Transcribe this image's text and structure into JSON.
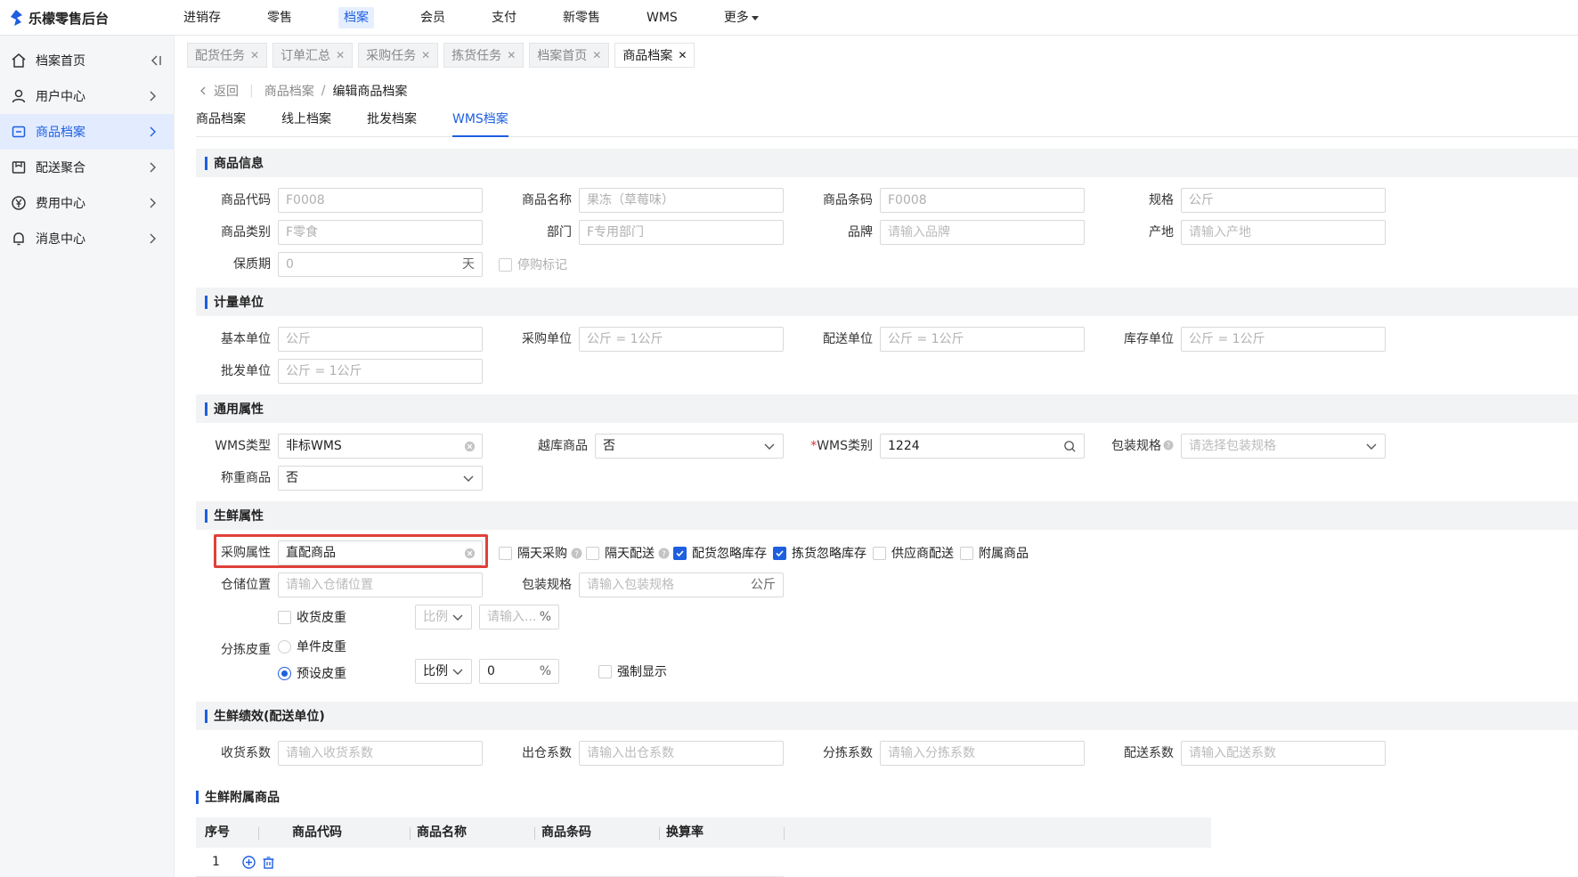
{
  "app": {
    "title": "乐檬零售后台"
  },
  "topnav": [
    {
      "label": "进销存",
      "active": false
    },
    {
      "label": "零售",
      "active": false
    },
    {
      "label": "档案",
      "active": true
    },
    {
      "label": "会员",
      "active": false
    },
    {
      "label": "支付",
      "active": false
    },
    {
      "label": "新零售",
      "active": false
    },
    {
      "label": "WMS",
      "active": false
    },
    {
      "label": "更多",
      "active": false
    }
  ],
  "sidebar": [
    {
      "label": "档案首页",
      "icon": "home-icon"
    },
    {
      "label": "用户中心",
      "icon": "user-icon"
    },
    {
      "label": "商品档案",
      "icon": "product-icon",
      "active": true
    },
    {
      "label": "配送聚合",
      "icon": "delivery-icon"
    },
    {
      "label": "费用中心",
      "icon": "yen-icon"
    },
    {
      "label": "消息中心",
      "icon": "bell-icon"
    }
  ],
  "tabs": [
    {
      "label": "配货任务"
    },
    {
      "label": "订单汇总"
    },
    {
      "label": "采购任务"
    },
    {
      "label": "拣货任务"
    },
    {
      "label": "档案首页"
    },
    {
      "label": "商品档案",
      "active": true
    }
  ],
  "breadcrumb": {
    "back": "返回",
    "parent": "商品档案",
    "sep": "/",
    "current": "编辑商品档案"
  },
  "page_tabs": [
    {
      "label": "商品档案"
    },
    {
      "label": "线上档案"
    },
    {
      "label": "批发档案"
    },
    {
      "label": "WMS档案",
      "active": true
    }
  ],
  "sections": {
    "product_info": "商品信息",
    "units": "计量单位",
    "general": "通用属性",
    "fresh": "生鲜属性",
    "fresh_perf": "生鲜绩效(配送单位)",
    "fresh_sub": "生鲜附属商品"
  },
  "product_info": {
    "code_label": "商品代码",
    "code": "F0008",
    "name_label": "商品名称",
    "name": "果冻（草莓味）",
    "barcode_label": "商品条码",
    "barcode": "F0008",
    "spec_label": "规格",
    "spec": "公斤",
    "category_label": "商品类别",
    "category": "F零食",
    "dept_label": "部门",
    "dept": "F专用部门",
    "brand_label": "品牌",
    "brand_ph": "请输入品牌",
    "origin_label": "产地",
    "origin_ph": "请输入产地",
    "shelf_label": "保质期",
    "shelf": "0",
    "shelf_unit": "天",
    "stop_label": "停购标记"
  },
  "units": {
    "base_label": "基本单位",
    "base": "公斤",
    "purchase_label": "采购单位",
    "purchase": "公斤 = 1公斤",
    "delivery_label": "配送单位",
    "delivery": "公斤 = 1公斤",
    "stock_label": "库存单位",
    "stock": "公斤 = 1公斤",
    "wholesale_label": "批发单位",
    "wholesale": "公斤 = 1公斤"
  },
  "general": {
    "wms_type_label": "WMS类型",
    "wms_type": "非标WMS",
    "cross_label": "越库商品",
    "cross": "否",
    "wms_cat_label": "WMS类别",
    "wms_cat_req": "*",
    "wms_cat": "1224",
    "pack_label": "包装规格",
    "pack_ph": "请选择包装规格",
    "weigh_label": "称重商品",
    "weigh": "否"
  },
  "fresh": {
    "purchase_attr_label": "采购属性",
    "purchase_attr": "直配商品",
    "checks": [
      {
        "label": "隔天采购",
        "checked": false,
        "help": true
      },
      {
        "label": "隔天配送",
        "checked": false,
        "help": true
      },
      {
        "label": "配货忽略库存",
        "checked": true,
        "help": false
      },
      {
        "label": "拣货忽略库存",
        "checked": true,
        "help": false
      },
      {
        "label": "供应商配送",
        "checked": false,
        "help": false
      },
      {
        "label": "附属商品",
        "checked": false,
        "help": false
      }
    ],
    "location_label": "仓储位置",
    "location_ph": "请输入仓储位置",
    "pack_spec_label": "包装规格",
    "pack_spec_ph": "请输入包装规格",
    "pack_spec_unit": "公斤",
    "receive_tare_label": "收货皮重",
    "ratio_label": "比例",
    "ratio_ph": "请输入...",
    "pct": "%",
    "sort_tare_label": "分拣皮重",
    "single_tare_label": "单件皮重",
    "preset_tare_label": "预设皮重",
    "preset_ratio_label": "比例",
    "preset_value": "0",
    "preset_pct": "%",
    "force_label": "强制显示"
  },
  "fresh_perf": {
    "recv_label": "收货系数",
    "recv_ph": "请输入收货系数",
    "out_label": "出仓系数",
    "out_ph": "请输入出仓系数",
    "sort_label": "分拣系数",
    "sort_ph": "请输入分拣系数",
    "deliv_label": "配送系数",
    "deliv_ph": "请输入配送系数"
  },
  "sub_table": {
    "columns": [
      "序号",
      "商品代码",
      "商品名称",
      "商品条码",
      "换算率"
    ],
    "rows": [
      {
        "index": "1"
      }
    ]
  },
  "colors": {
    "accent": "#1e5fe0",
    "highlight": "#e0403a"
  }
}
